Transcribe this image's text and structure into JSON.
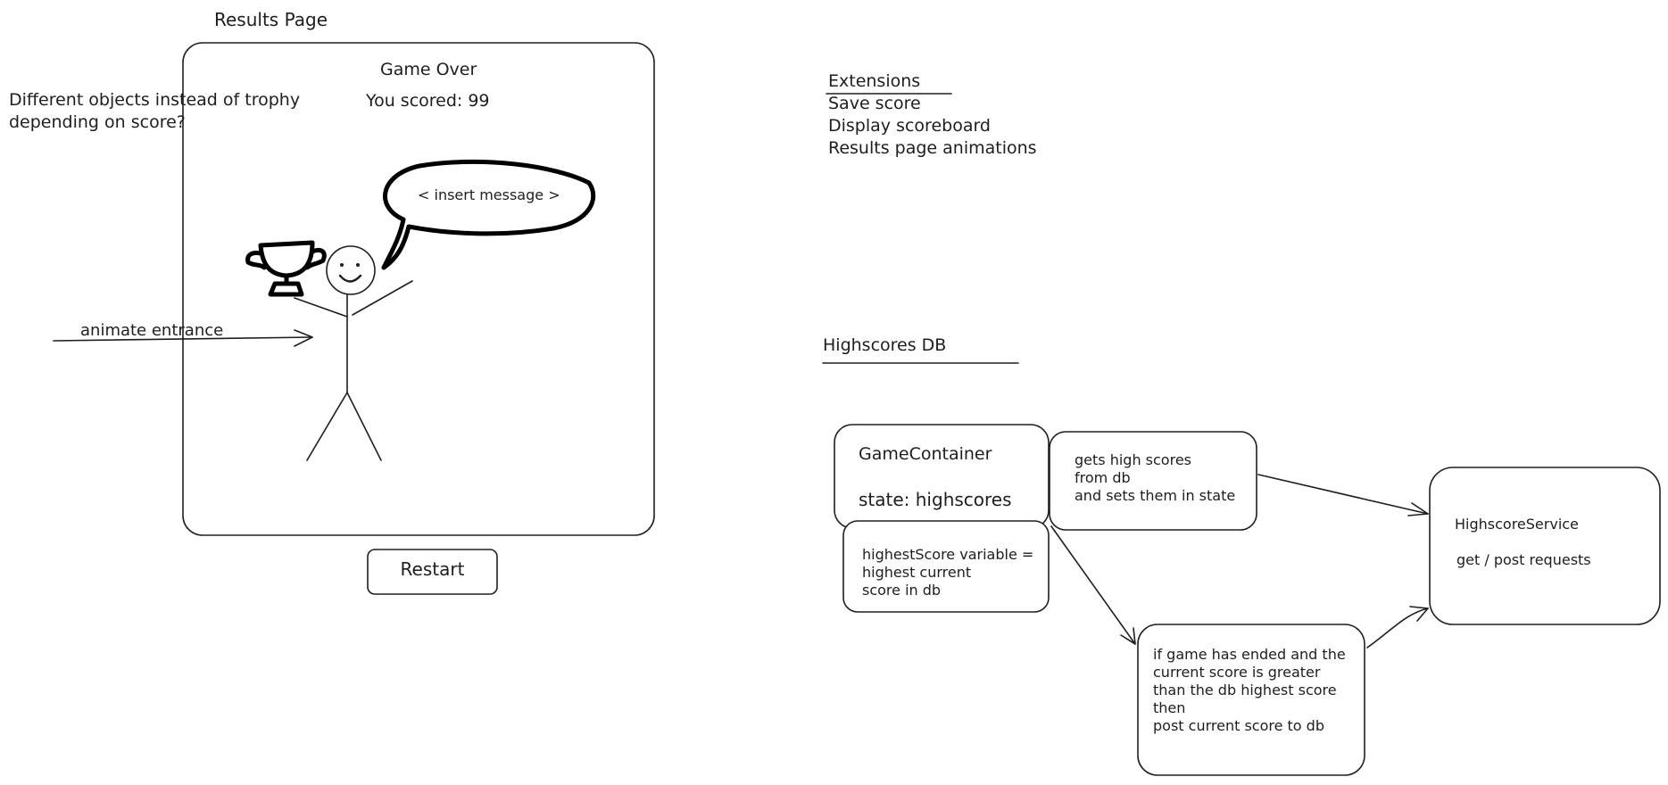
{
  "results_page": {
    "title": "Results Page",
    "game_over": "Game Over",
    "score_text": "You scored: 99",
    "speech_message": "< insert message >",
    "restart_label": "Restart",
    "note_objects": [
      "Different objects instead of trophy",
      "depending on score?"
    ],
    "animate_label": "animate entrance"
  },
  "extensions": {
    "heading": "Extensions",
    "items": [
      "Save score",
      "Display scoreboard",
      "Results page animations"
    ]
  },
  "db": {
    "heading": "Highscores DB",
    "game_container": {
      "title": "GameContainer",
      "state": "state: highscores"
    },
    "highest_score": [
      "highestScore variable =",
      "highest current",
      "score in db"
    ],
    "gets": [
      "gets high scores",
      "from db",
      "and sets them in state"
    ],
    "condition": [
      "if game has ended and the",
      "current score is greater",
      "than the db highest score",
      "then",
      "post current score to db"
    ],
    "service": {
      "title": "HighscoreService",
      "desc": "get / post requests"
    }
  }
}
